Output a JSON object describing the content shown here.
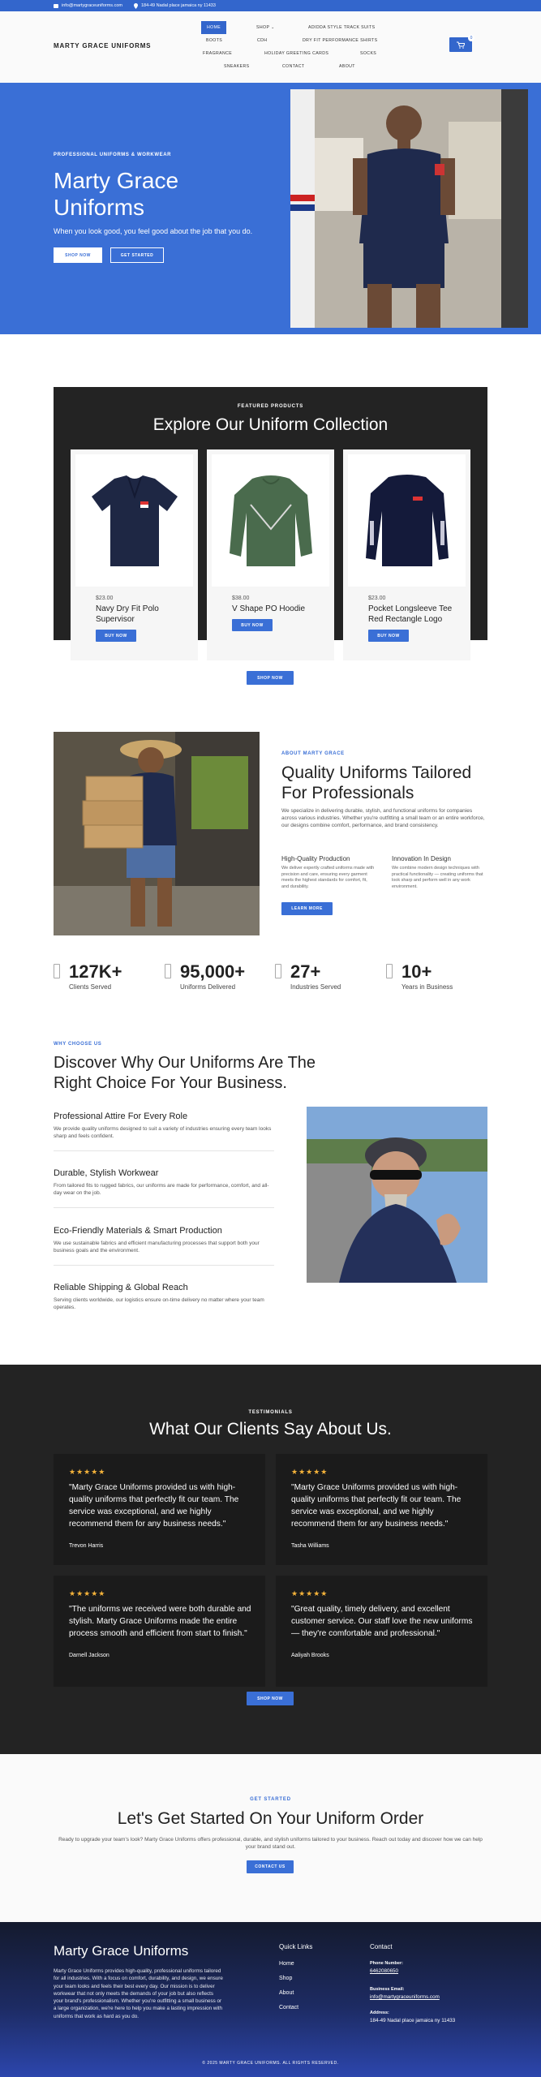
{
  "topbar": {
    "email": "info@martygraceuniforms.com",
    "address": "184-49 Nadal place jamaica ny 11433"
  },
  "header": {
    "logo": "MARTY GRACE UNIFORMS",
    "nav": [
      "HOME",
      "SHOP",
      "ADIDDA STYLE TRACK SUITS",
      "BOOTS",
      "CDH",
      "DRY FIT PERFORMANCE SHIRTS",
      "FRAGRANCE",
      "HOLIDAY GREETING CARDS",
      "SOCKS",
      "SNEAKERS",
      "CONTACT",
      "ABOUT"
    ],
    "shop_chevron": "⌄",
    "cart_count": "0"
  },
  "hero": {
    "kicker": "PROFESSIONAL UNIFORMS & WORKWEAR",
    "title": "Marty Grace Uniforms",
    "subtitle": "When you look good, you feel good about the job that you do.",
    "btn_shop": "SHOP NOW",
    "btn_start": "GET STARTED"
  },
  "collection": {
    "kicker": "FEATURED PRODUCTS",
    "title": "Explore Our Uniform Collection",
    "products": [
      {
        "price": "$23.00",
        "name": "Navy Dry Fit Polo Supervisor",
        "btn": "BUY NOW"
      },
      {
        "price": "$38.00",
        "name": "V Shape PO Hoodie",
        "btn": "BUY NOW"
      },
      {
        "price": "$23.00",
        "name": "Pocket Longsleeve Tee Red Rectangle Logo",
        "btn": "BUY NOW"
      }
    ],
    "shop_btn": "SHOP NOW"
  },
  "about": {
    "kicker": "ABOUT MARTY GRACE",
    "title": "Quality Uniforms Tailored For Professionals",
    "text": "We specialize in delivering durable, stylish, and functional uniforms for companies across various industries. Whether you're outfitting a small team or an entire workforce, our designs combine comfort, performance, and brand consistency.",
    "features": [
      {
        "title": "High-Quality Production",
        "text": "We deliver expertly crafted uniforms made with precision and care, ensuring every garment meets the highest standards for comfort, fit, and durability."
      },
      {
        "title": "Innovation In Design",
        "text": "We combine modern design techniques with practical functionality — creating uniforms that look sharp and perform well in any work environment."
      }
    ],
    "learn_btn": "LEARN MORE",
    "stats": [
      {
        "num": "127K+",
        "label": "Clients Served"
      },
      {
        "num": "95,000+",
        "label": "Uniforms Delivered"
      },
      {
        "num": "27+",
        "label": "Industries Served"
      },
      {
        "num": "10+",
        "label": "Years in Business"
      }
    ]
  },
  "why": {
    "kicker": "WHY CHOOSE US",
    "title": "Discover Why Our Uniforms Are The Right Choice For Your Business.",
    "items": [
      {
        "title": "Professional Attire For Every Role",
        "text": "We provide quality uniforms designed to suit a variety of industries ensuring every team looks sharp and feels confident."
      },
      {
        "title": "Durable, Stylish Workwear",
        "text": "From tailored fits to rugged fabrics, our uniforms are made for performance, comfort, and all-day wear on the job."
      },
      {
        "title": "Eco-Friendly Materials & Smart Production",
        "text": "We use sustainable fabrics and efficient manufacturing processes that support both your business goals and the environment."
      },
      {
        "title": "Reliable Shipping & Global Reach",
        "text": "Serving clients worldwide, our logistics ensure on-time delivery no matter where your team operates."
      }
    ]
  },
  "testimonials": {
    "kicker": "TESTIMONIALS",
    "title": "What Our Clients Say About Us.",
    "stars": "★★★★★",
    "items": [
      {
        "quote": "\"Marty Grace Uniforms provided us with high-quality uniforms that perfectly fit our team. The service was exceptional, and we highly recommend them for any business needs.\"",
        "author": "Trevon Harris"
      },
      {
        "quote": "\"Marty Grace Uniforms provided us with high-quality uniforms that perfectly fit our team. The service was exceptional, and we highly recommend them for any business needs.\"",
        "author": "Tasha Williams"
      },
      {
        "quote": "\"The uniforms we received were both durable and stylish. Marty Grace Uniforms made the entire process smooth and efficient from start to finish.\"",
        "author": "Darnell Jackson"
      },
      {
        "quote": "\"Great quality, timely delivery, and excellent customer service. Our staff love the new uniforms — they're comfortable and professional.\"",
        "author": "Aaliyah Brooks"
      }
    ],
    "shop_btn": "SHOP NOW"
  },
  "cta": {
    "kicker": "GET STARTED",
    "title": "Let's Get Started On Your Uniform Order",
    "text": "Ready to upgrade your team's look? Marty Grace Uniforms offers professional, durable, and stylish uniforms tailored to your business. Reach out today and discover how we can help your brand stand out.",
    "btn": "CONTACT US"
  },
  "footer": {
    "brand": "Marty Grace Uniforms",
    "desc": "Marty Grace Uniforms provides high-quality, professional uniforms tailored for all industries. With a focus on comfort, durability, and design, we ensure your team looks and feels their best every day. Our mission is to deliver workwear that not only meets the demands of your job but also reflects your brand's professionalism. Whether you're outfitting a small business or a large organization, we're here to help you make a lasting impression with uniforms that work as hard as you do.",
    "quick_title": "Quick Links",
    "quick_links": [
      "Home",
      "Shop",
      "About",
      "Contact"
    ],
    "contact_title": "Contact",
    "phone_label": "Phone Number:",
    "phone": "6462080650",
    "email_label": "Business Email:",
    "email": "info@martygraceuniforms.com",
    "address_label": "Address:",
    "address": "184-49 Nadal place jamaica ny 11433",
    "copyright": "© 2025 MARTY GRACE UNIFORMS. ALL RIGHTS RESERVED."
  },
  "colors": {
    "accent": "#3a6fd6",
    "dark": "#232323",
    "star": "#f3b23a"
  }
}
